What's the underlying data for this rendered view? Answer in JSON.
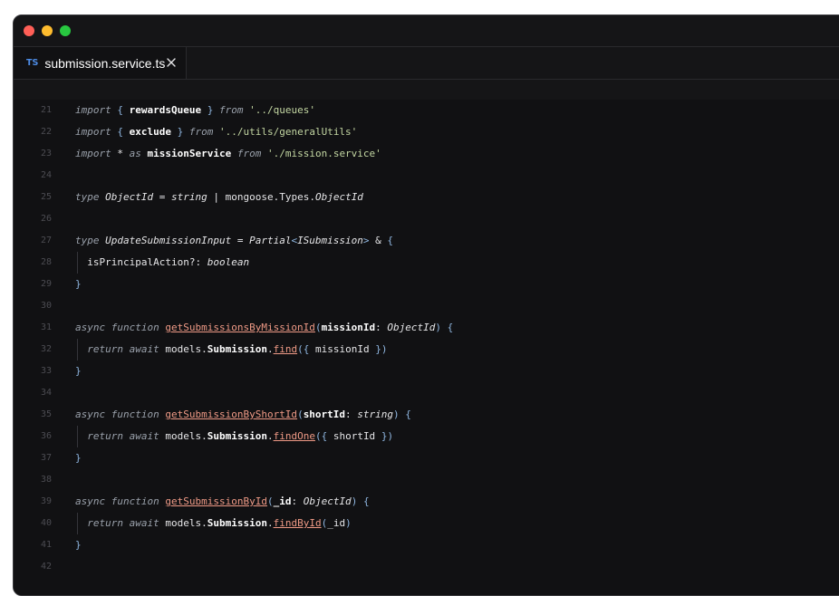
{
  "window": {
    "controls": [
      "close",
      "minimize",
      "zoom"
    ]
  },
  "tab": {
    "icon": "TS",
    "title": "submission.service.ts",
    "close_icon": "close-icon"
  },
  "lines": [
    {
      "num": "21",
      "tokens": [
        {
          "t": "import",
          "c": "kw"
        },
        {
          "t": " ",
          "c": "plain"
        },
        {
          "t": "{",
          "c": "brace"
        },
        {
          "t": " ",
          "c": "plain"
        },
        {
          "t": "rewardsQueue",
          "c": "ident"
        },
        {
          "t": " ",
          "c": "plain"
        },
        {
          "t": "}",
          "c": "brace"
        },
        {
          "t": " ",
          "c": "plain"
        },
        {
          "t": "from",
          "c": "kw"
        },
        {
          "t": " ",
          "c": "plain"
        },
        {
          "t": "'../queues'",
          "c": "str"
        }
      ]
    },
    {
      "num": "22",
      "tokens": [
        {
          "t": "import",
          "c": "kw"
        },
        {
          "t": " ",
          "c": "plain"
        },
        {
          "t": "{",
          "c": "brace"
        },
        {
          "t": " ",
          "c": "plain"
        },
        {
          "t": "exclude",
          "c": "ident"
        },
        {
          "t": " ",
          "c": "plain"
        },
        {
          "t": "}",
          "c": "brace"
        },
        {
          "t": " ",
          "c": "plain"
        },
        {
          "t": "from",
          "c": "kw"
        },
        {
          "t": " ",
          "c": "plain"
        },
        {
          "t": "'../utils/generalUtils'",
          "c": "str"
        }
      ]
    },
    {
      "num": "23",
      "tokens": [
        {
          "t": "import",
          "c": "kw"
        },
        {
          "t": " * ",
          "c": "plain"
        },
        {
          "t": "as",
          "c": "kw"
        },
        {
          "t": " ",
          "c": "plain"
        },
        {
          "t": "missionService",
          "c": "ident"
        },
        {
          "t": " ",
          "c": "plain"
        },
        {
          "t": "from",
          "c": "kw"
        },
        {
          "t": " ",
          "c": "plain"
        },
        {
          "t": "'./mission.service'",
          "c": "str"
        }
      ]
    },
    {
      "num": "24",
      "tokens": []
    },
    {
      "num": "25",
      "tokens": [
        {
          "t": "type",
          "c": "kw"
        },
        {
          "t": " ",
          "c": "plain"
        },
        {
          "t": "ObjectId",
          "c": "type"
        },
        {
          "t": " = ",
          "c": "plain"
        },
        {
          "t": "string",
          "c": "type"
        },
        {
          "t": " | mongoose.Types.",
          "c": "plain"
        },
        {
          "t": "ObjectId",
          "c": "type"
        }
      ]
    },
    {
      "num": "26",
      "tokens": []
    },
    {
      "num": "27",
      "tokens": [
        {
          "t": "type",
          "c": "kw"
        },
        {
          "t": " ",
          "c": "plain"
        },
        {
          "t": "UpdateSubmissionInput",
          "c": "type"
        },
        {
          "t": " = ",
          "c": "plain"
        },
        {
          "t": "Partial",
          "c": "type"
        },
        {
          "t": "<",
          "c": "brace"
        },
        {
          "t": "ISubmission",
          "c": "type"
        },
        {
          "t": ">",
          "c": "brace"
        },
        {
          "t": " & ",
          "c": "plain"
        },
        {
          "t": "{",
          "c": "brace"
        }
      ]
    },
    {
      "num": "28",
      "tokens": [
        {
          "t": "  isPrincipalAction?: ",
          "c": "plain"
        },
        {
          "t": "boolean",
          "c": "type"
        }
      ]
    },
    {
      "num": "29",
      "tokens": [
        {
          "t": "}",
          "c": "brace"
        }
      ]
    },
    {
      "num": "30",
      "tokens": []
    },
    {
      "num": "31",
      "tokens": [
        {
          "t": "async",
          "c": "kw"
        },
        {
          "t": " ",
          "c": "plain"
        },
        {
          "t": "function",
          "c": "kw"
        },
        {
          "t": " ",
          "c": "plain"
        },
        {
          "t": "getSubmissionsByMissionId",
          "c": "fn"
        },
        {
          "t": "(",
          "c": "brace"
        },
        {
          "t": "missionId",
          "c": "ident"
        },
        {
          "t": ": ",
          "c": "plain"
        },
        {
          "t": "ObjectId",
          "c": "type"
        },
        {
          "t": ")",
          "c": "brace"
        },
        {
          "t": " ",
          "c": "plain"
        },
        {
          "t": "{",
          "c": "brace"
        }
      ]
    },
    {
      "num": "32",
      "tokens": [
        {
          "t": "  ",
          "c": "plain"
        },
        {
          "t": "return",
          "c": "kw"
        },
        {
          "t": " ",
          "c": "plain"
        },
        {
          "t": "await",
          "c": "kw"
        },
        {
          "t": " models.",
          "c": "plain"
        },
        {
          "t": "Submission",
          "c": "ident"
        },
        {
          "t": ".",
          "c": "plain"
        },
        {
          "t": "find",
          "c": "fn"
        },
        {
          "t": "(",
          "c": "brace"
        },
        {
          "t": "{",
          "c": "brace"
        },
        {
          "t": " missionId ",
          "c": "plain"
        },
        {
          "t": "}",
          "c": "brace"
        },
        {
          "t": ")",
          "c": "brace"
        }
      ]
    },
    {
      "num": "33",
      "tokens": [
        {
          "t": "}",
          "c": "brace"
        }
      ]
    },
    {
      "num": "34",
      "tokens": []
    },
    {
      "num": "35",
      "tokens": [
        {
          "t": "async",
          "c": "kw"
        },
        {
          "t": " ",
          "c": "plain"
        },
        {
          "t": "function",
          "c": "kw"
        },
        {
          "t": " ",
          "c": "plain"
        },
        {
          "t": "getSubmissionByShortId",
          "c": "fn"
        },
        {
          "t": "(",
          "c": "brace"
        },
        {
          "t": "shortId",
          "c": "ident"
        },
        {
          "t": ": ",
          "c": "plain"
        },
        {
          "t": "string",
          "c": "type"
        },
        {
          "t": ")",
          "c": "brace"
        },
        {
          "t": " ",
          "c": "plain"
        },
        {
          "t": "{",
          "c": "brace"
        }
      ]
    },
    {
      "num": "36",
      "tokens": [
        {
          "t": "  ",
          "c": "plain"
        },
        {
          "t": "return",
          "c": "kw"
        },
        {
          "t": " ",
          "c": "plain"
        },
        {
          "t": "await",
          "c": "kw"
        },
        {
          "t": " models.",
          "c": "plain"
        },
        {
          "t": "Submission",
          "c": "ident"
        },
        {
          "t": ".",
          "c": "plain"
        },
        {
          "t": "findOne",
          "c": "fn"
        },
        {
          "t": "(",
          "c": "brace"
        },
        {
          "t": "{",
          "c": "brace"
        },
        {
          "t": " shortId ",
          "c": "plain"
        },
        {
          "t": "}",
          "c": "brace"
        },
        {
          "t": ")",
          "c": "brace"
        }
      ]
    },
    {
      "num": "37",
      "tokens": [
        {
          "t": "}",
          "c": "brace"
        }
      ]
    },
    {
      "num": "38",
      "tokens": []
    },
    {
      "num": "39",
      "tokens": [
        {
          "t": "async",
          "c": "kw"
        },
        {
          "t": " ",
          "c": "plain"
        },
        {
          "t": "function",
          "c": "kw"
        },
        {
          "t": " ",
          "c": "plain"
        },
        {
          "t": "getSubmissionById",
          "c": "fn"
        },
        {
          "t": "(",
          "c": "brace"
        },
        {
          "t": "_id",
          "c": "ident"
        },
        {
          "t": ": ",
          "c": "plain"
        },
        {
          "t": "ObjectId",
          "c": "type"
        },
        {
          "t": ")",
          "c": "brace"
        },
        {
          "t": " ",
          "c": "plain"
        },
        {
          "t": "{",
          "c": "brace"
        }
      ]
    },
    {
      "num": "40",
      "tokens": [
        {
          "t": "  ",
          "c": "plain"
        },
        {
          "t": "return",
          "c": "kw"
        },
        {
          "t": " ",
          "c": "plain"
        },
        {
          "t": "await",
          "c": "kw"
        },
        {
          "t": " models.",
          "c": "plain"
        },
        {
          "t": "Submission",
          "c": "ident"
        },
        {
          "t": ".",
          "c": "plain"
        },
        {
          "t": "findById",
          "c": "fn"
        },
        {
          "t": "(",
          "c": "brace"
        },
        {
          "t": "_id",
          "c": "plain"
        },
        {
          "t": ")",
          "c": "brace"
        }
      ]
    },
    {
      "num": "41",
      "tokens": [
        {
          "t": "}",
          "c": "brace"
        }
      ]
    },
    {
      "num": "42",
      "tokens": []
    }
  ]
}
